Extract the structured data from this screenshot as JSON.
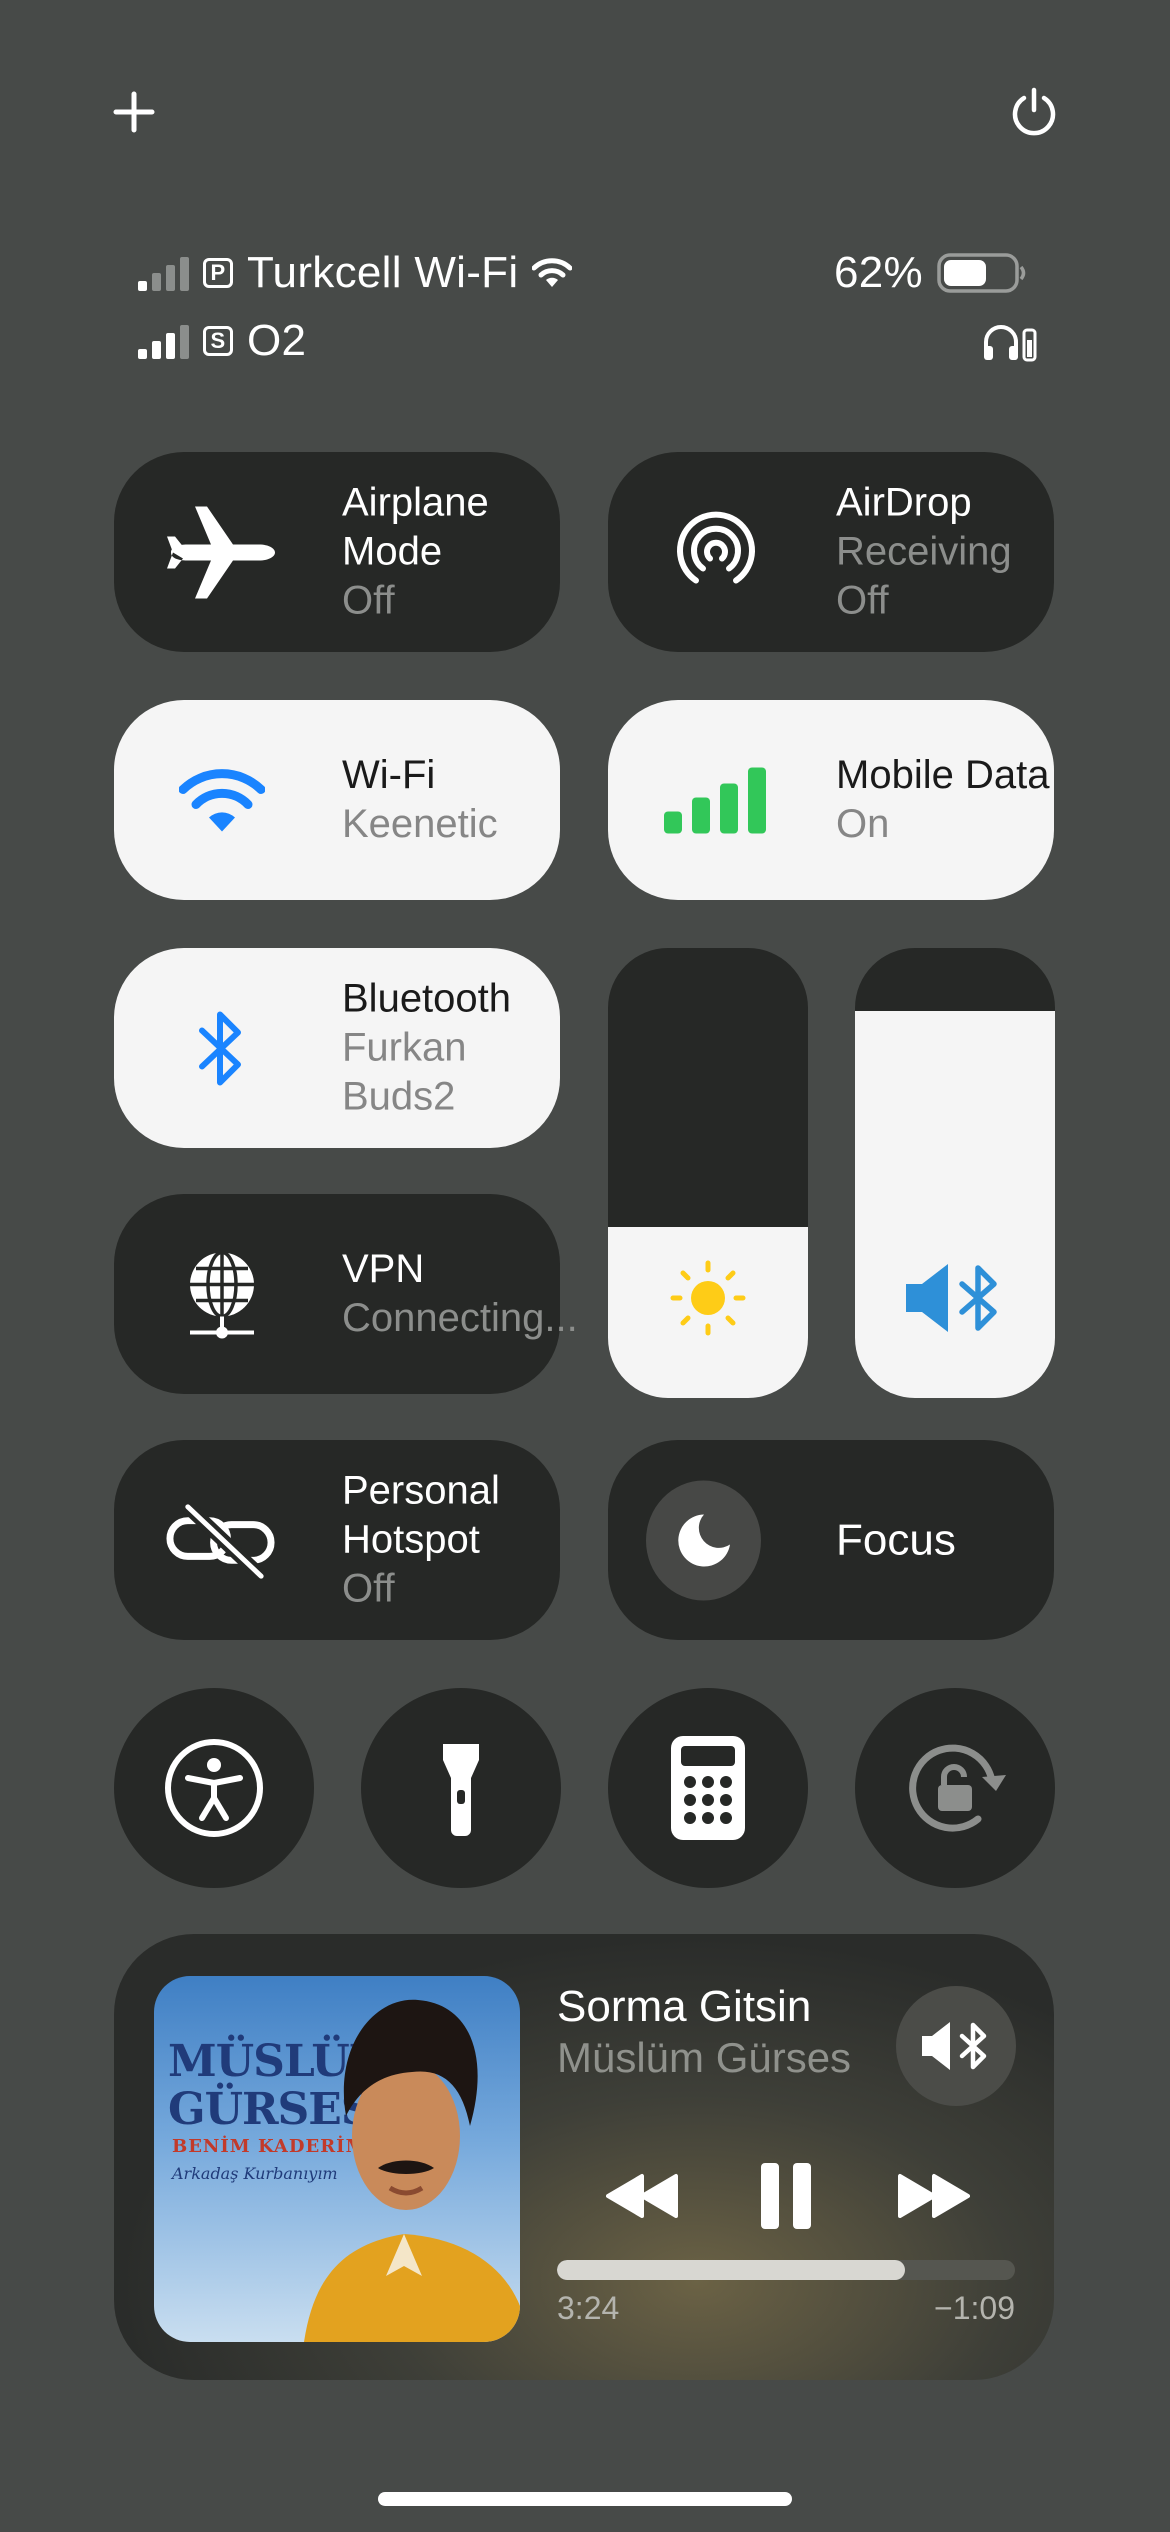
{
  "top": {
    "add_icon": "plus-icon",
    "power_icon": "power-icon"
  },
  "status": {
    "line1": {
      "sim_badge": "P",
      "carrier": "Turkcell Wi-Fi",
      "battery": "62%",
      "battery_level": 0.62
    },
    "line2": {
      "sim_badge": "S",
      "carrier": "O2"
    }
  },
  "tiles": {
    "airplane": {
      "title_line1": "Airplane",
      "title_line2": "Mode",
      "status": "Off"
    },
    "airdrop": {
      "title": "AirDrop",
      "status": "Receiving Off"
    },
    "wifi": {
      "title": "Wi-Fi",
      "status": "Keenetic"
    },
    "mobile": {
      "title": "Mobile Data",
      "status": "On"
    },
    "bluetooth": {
      "title": "Bluetooth",
      "status": "Furkan Buds2"
    },
    "vpn": {
      "title": "VPN",
      "status": "Connecting..."
    },
    "hotspot": {
      "title_line1": "Personal",
      "title_line2": "Hotspot",
      "status": "Off"
    },
    "focus": {
      "title": "Focus"
    }
  },
  "sliders": {
    "brightness_level": 0.38,
    "volume_level": 0.86
  },
  "colors": {
    "wifi_blue": "#1a84ff",
    "mobile_green": "#32c759",
    "sun_yellow": "#fecc17"
  },
  "player": {
    "title": "Sorma Gitsin",
    "artist": "Müslüm Gürses",
    "progress": 0.76,
    "elapsed": "3:24",
    "remaining": "−1:09",
    "album": {
      "line1": "MÜSLÜM",
      "line2": "GÜRSES",
      "line3": "BENİM KADERİM",
      "line4": "Arkadaş Kurbanıyım"
    }
  }
}
